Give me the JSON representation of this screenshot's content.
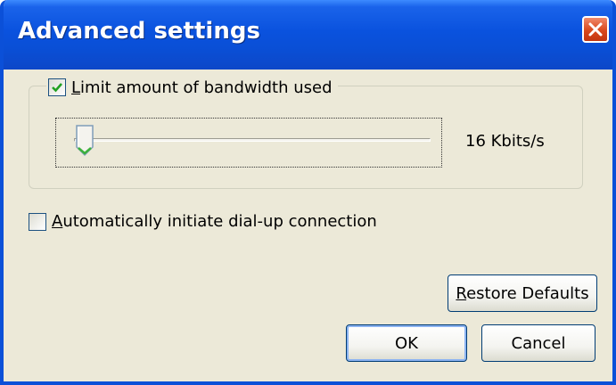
{
  "window": {
    "title": "Advanced settings",
    "close_icon": "close-icon"
  },
  "bandwidth": {
    "label": "Limit amount of bandwidth used",
    "checked": true,
    "slider_value_label": "16 Kbits/s",
    "slider_level_fraction": 0.0
  },
  "dialup": {
    "label": "Automatically initiate dial-up connection",
    "checked": false
  },
  "buttons": {
    "restore_label": "Restore Defaults",
    "ok_label": "OK",
    "cancel_label": "Cancel"
  },
  "colors": {
    "titlebar": "#0a52de",
    "close_button": "#d9481c",
    "dialog_background": "#ece9d8",
    "checkmark": "#21a121",
    "slider_thumb_accent": "#3cb13c"
  }
}
